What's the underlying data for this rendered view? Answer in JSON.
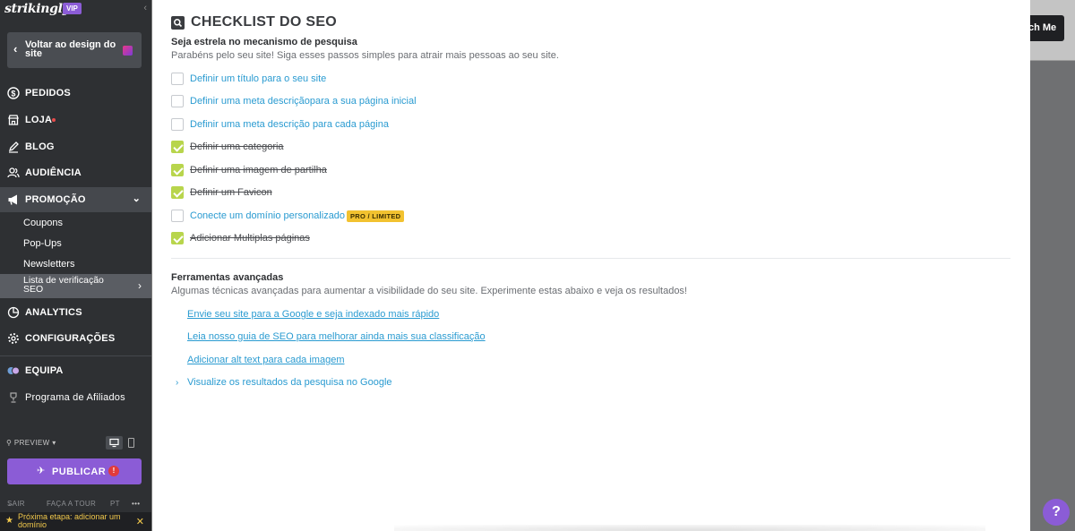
{
  "brand": {
    "logo": "strikingly",
    "vip": "VIP"
  },
  "back_button": {
    "label": "Voltar ao design do site"
  },
  "nav": {
    "pedidos": "PEDIDOS",
    "loja": "LOJA",
    "blog": "BLOG",
    "audiencia": "AUDIÊNCIA",
    "promocao": "PROMOÇÃO",
    "promocao_subitems": [
      "Coupons",
      "Pop-Ups",
      "Newsletters"
    ],
    "promocao_active": "Lista de verificação SEO",
    "analytics": "ANALYTICS",
    "configuracoes": "CONFIGURAÇÕES",
    "equipa": "EQUIPA",
    "afiliados": "Programa de Afiliados"
  },
  "bottom": {
    "preview": "PREVIEW",
    "publish": "PUBLICAR",
    "sair": "SAIR",
    "tour": "FAÇA A TOUR",
    "lang": "PT",
    "more": "•••",
    "next_step": "Próxima etapa: adicionar um domínio"
  },
  "panel": {
    "title": "CHECKLIST DO SEO",
    "section1": {
      "heading": "Seja estrela no mecanismo de pesquisa",
      "desc": "Parabéns pelo seu site! Siga esses passos simples para atrair mais pessoas ao seu site."
    },
    "checklist": [
      {
        "label": "Definir um título para o seu site",
        "done": false
      },
      {
        "label": "Definir uma meta descriçãopara a sua página inicial",
        "done": false
      },
      {
        "label": "Definir uma meta descrição para cada página",
        "done": false
      },
      {
        "label": "Definir uma categoria",
        "done": true
      },
      {
        "label": "Definir uma imagem de partilha",
        "done": true
      },
      {
        "label": "Definir um Favicon",
        "done": true
      },
      {
        "label": "Conecte um domínio personalizado",
        "done": false,
        "badge": "PRO / LIMITED"
      },
      {
        "label": "Adicionar Multiplas páginas",
        "done": true
      }
    ],
    "section2": {
      "heading": "Ferramentas avançadas",
      "desc": "Algumas técnicas avançadas para aumentar a visibilidade do seu site. Experimente estas abaixo e veja os resultados!"
    },
    "tools": [
      "Envie seu site para a Google e seja indexado mais rápido",
      "Leia nosso guia de SEO para melhorar ainda mais sua classificação",
      "Adicionar alt text para cada imagem"
    ],
    "google_results": "Visualize os resultados da pesquisa no Google"
  },
  "right": {
    "match_button": "ch Me",
    "help": "?"
  }
}
